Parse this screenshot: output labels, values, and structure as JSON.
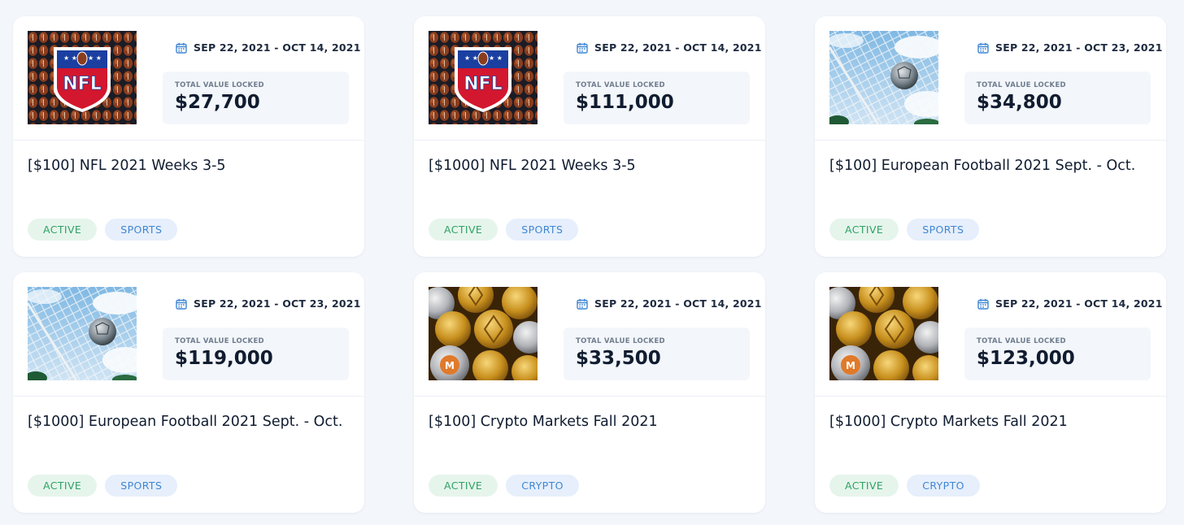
{
  "cards": [
    {
      "date_range": "SEP 22, 2021 - OCT 14, 2021",
      "tvl_label": "TOTAL VALUE LOCKED",
      "tvl_value": "$27,700",
      "title": "[$100] NFL 2021 Weeks 3-5",
      "status": "ACTIVE",
      "category": "SPORTS",
      "image": "nfl-logo",
      "image_text": "NFL"
    },
    {
      "date_range": "SEP 22, 2021 - OCT 14, 2021",
      "tvl_label": "TOTAL VALUE LOCKED",
      "tvl_value": "$111,000",
      "title": "[$1000] NFL 2021 Weeks 3-5",
      "status": "ACTIVE",
      "category": "SPORTS",
      "image": "nfl-logo",
      "image_text": "NFL"
    },
    {
      "date_range": "SEP 22, 2021 - OCT 23, 2021",
      "tvl_label": "TOTAL VALUE LOCKED",
      "tvl_value": "$34,800",
      "title": "[$100] European Football 2021 Sept. - Oct.",
      "status": "ACTIVE",
      "category": "SPORTS",
      "image": "soccer-net"
    },
    {
      "date_range": "SEP 22, 2021 - OCT 23, 2021",
      "tvl_label": "TOTAL VALUE LOCKED",
      "tvl_value": "$119,000",
      "title": "[$1000] European Football 2021 Sept. - Oct.",
      "status": "ACTIVE",
      "category": "SPORTS",
      "image": "soccer-net"
    },
    {
      "date_range": "SEP 22, 2021 - OCT 14, 2021",
      "tvl_label": "TOTAL VALUE LOCKED",
      "tvl_value": "$33,500",
      "title": "[$100] Crypto Markets Fall 2021",
      "status": "ACTIVE",
      "category": "CRYPTO",
      "image": "crypto-coins"
    },
    {
      "date_range": "SEP 22, 2021 - OCT 14, 2021",
      "tvl_label": "TOTAL VALUE LOCKED",
      "tvl_value": "$123,000",
      "title": "[$1000] Crypto Markets Fall 2021",
      "status": "ACTIVE",
      "category": "CRYPTO",
      "image": "crypto-coins"
    }
  ],
  "colors": {
    "background": "#f3f6fa",
    "status_active_bg": "#e6f5ec",
    "status_active_text": "#2ea164",
    "category_bg": "#e6effb",
    "category_text": "#3f86d2",
    "calendar_icon": "#3f86d2"
  },
  "icons": {
    "date": "calendar-icon"
  }
}
